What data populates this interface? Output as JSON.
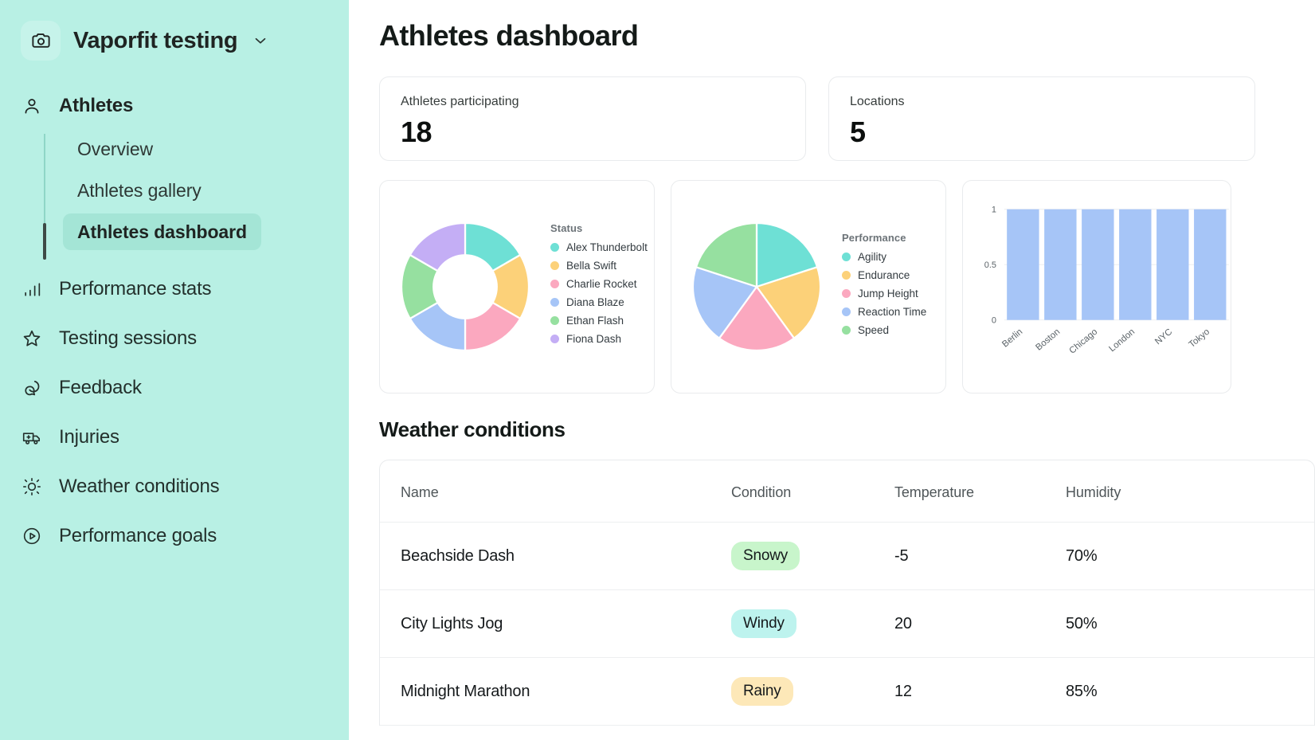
{
  "sidebar": {
    "brand": {
      "title": "Vaporfit testing",
      "logo_icon": "camera-icon",
      "caret_icon": "chevron-down-icon"
    },
    "section": {
      "label": "Athletes",
      "icon": "user-icon",
      "subitems": [
        {
          "label": "Overview",
          "active": false
        },
        {
          "label": "Athletes gallery",
          "active": false
        },
        {
          "label": "Athletes dashboard",
          "active": true
        }
      ]
    },
    "items": [
      {
        "label": "Performance stats",
        "icon": "bar-chart-icon"
      },
      {
        "label": "Testing sessions",
        "icon": "star-icon"
      },
      {
        "label": "Feedback",
        "icon": "chat-bubbles-icon"
      },
      {
        "label": "Injuries",
        "icon": "ambulance-icon"
      },
      {
        "label": "Weather conditions",
        "icon": "sun-icon"
      },
      {
        "label": "Performance goals",
        "icon": "play-circle-icon"
      }
    ],
    "colors": {
      "background": "#b8f0e4",
      "active_pill": "#a4e5d6",
      "rail": "#8fd6c7"
    }
  },
  "main": {
    "page_title": "Athletes dashboard",
    "kpis": [
      {
        "label": "Athletes participating",
        "value": "18"
      },
      {
        "label": "Locations",
        "value": "5"
      }
    ],
    "weather_section_title": "Weather conditions",
    "table": {
      "columns": [
        "Name",
        "Condition",
        "Temperature",
        "Humidity"
      ],
      "rows": [
        {
          "name": "Beachside Dash",
          "condition": "Snowy",
          "condition_color": "#c8f5cb",
          "temperature": "-5",
          "humidity": "70%"
        },
        {
          "name": "City Lights Jog",
          "condition": "Windy",
          "condition_color": "#bdf3ee",
          "temperature": "20",
          "humidity": "50%"
        },
        {
          "name": "Midnight Marathon",
          "condition": "Rainy",
          "condition_color": "#fde8b8",
          "temperature": "12",
          "humidity": "85%"
        }
      ]
    }
  },
  "chart_data": [
    {
      "type": "pie",
      "variant": "donut",
      "title": "",
      "legend_title": "Status",
      "legend_position": "right",
      "categories": [
        "Alex Thunderbolt",
        "Bella Swift",
        "Charlie Rocket",
        "Diana Blaze",
        "Ethan Flash",
        "Fiona Dash"
      ],
      "values": [
        1,
        1,
        1,
        1,
        1,
        1
      ],
      "colors": [
        "#6ee0d5",
        "#fcd179",
        "#fba8bf",
        "#a6c5f7",
        "#96e0a0",
        "#c4aef5"
      ]
    },
    {
      "type": "pie",
      "title": "",
      "legend_title": "Performance",
      "legend_position": "right",
      "categories": [
        "Agility",
        "Endurance",
        "Jump Height",
        "Reaction Time",
        "Speed"
      ],
      "values": [
        1,
        1,
        1,
        1,
        1
      ],
      "colors": [
        "#6ee0d5",
        "#fcd179",
        "#fba8bf",
        "#a6c5f7",
        "#96e0a0"
      ]
    },
    {
      "type": "bar",
      "title": "",
      "categories": [
        "Berlin",
        "Boston",
        "Chicago",
        "London",
        "NYC",
        "Tokyo"
      ],
      "values": [
        1,
        1,
        1,
        1,
        1,
        1
      ],
      "xlabel": "",
      "ylabel": "",
      "ylim": [
        0,
        1
      ],
      "yticks": [
        "0",
        "0.5",
        "1"
      ],
      "grid": true,
      "bar_color": "#a6c5f7"
    }
  ]
}
